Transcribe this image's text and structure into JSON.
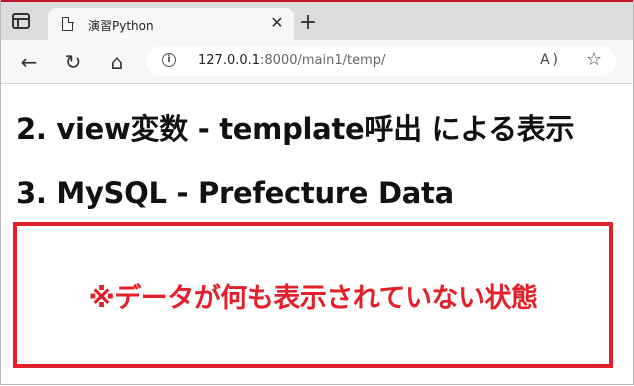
{
  "browser": {
    "tab_title": "演習Python",
    "tab_close": "✕",
    "new_tab": "+",
    "url_host": "127.0.0.1",
    "url_rest": ":8000/main1/temp/",
    "back": "←",
    "reload": "↻",
    "home": "⌂",
    "read_aloud": "A )",
    "favorite": "☆"
  },
  "page": {
    "heading_2": "2. view変数 - template呼出 による表示",
    "heading_3": "3. MySQL - Prefecture Data",
    "notice": "※データが何も表示されていない状態"
  },
  "colors": {
    "accent_red": "#e4202a"
  }
}
